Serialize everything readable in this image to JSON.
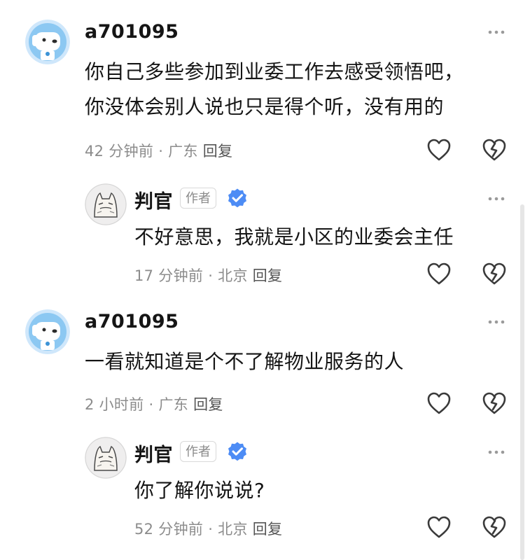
{
  "comments": [
    {
      "username": "a701095",
      "lines": [
        "你自己多些参加到业委工作去感受领悟吧，",
        "你没体会别人说也只是得个听，没有用的"
      ],
      "time": "42 分钟前",
      "location": "广东",
      "reply_label": "回复",
      "avatar_icon": "dog-avatar-icon"
    },
    {
      "username": "判官",
      "badge": "作者",
      "lines": [
        "不好意思，我就是小区的业委会主任"
      ],
      "time": "17 分钟前",
      "location": "北京",
      "reply_label": "回复",
      "avatar_icon": "cat-avatar-icon"
    },
    {
      "username": "a701095",
      "lines": [
        "一看就知道是个不了解物业服务的人"
      ],
      "time": "2 小时前",
      "location": "广东",
      "reply_label": "回复",
      "avatar_icon": "dog-avatar-icon"
    },
    {
      "username": "判官",
      "badge": "作者",
      "lines": [
        "你了解你说说?"
      ],
      "time": "52 分钟前",
      "location": "北京",
      "reply_label": "回复",
      "avatar_icon": "cat-avatar-icon"
    }
  ],
  "separator": "·",
  "colors": {
    "text": "#151515",
    "meta": "#8c8c8c",
    "verified": "#4d8cf5",
    "avatar_bg": "#cfe7fb"
  }
}
